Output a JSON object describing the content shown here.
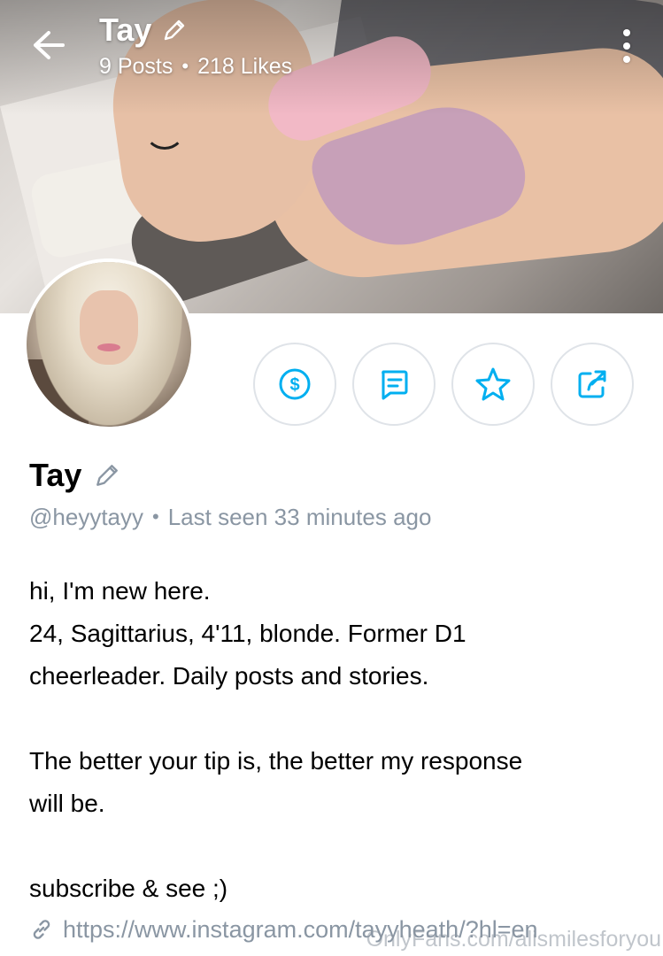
{
  "header": {
    "title": "Tay",
    "posts": "9 Posts",
    "likes": "218 Likes"
  },
  "icons": {
    "back": "arrow-left-icon",
    "edit": "pencil-icon",
    "menu": "more-vertical-icon",
    "tip": "dollar-circle-icon",
    "message": "message-icon",
    "favorite": "star-icon",
    "share": "share-icon",
    "link": "link-icon"
  },
  "colors": {
    "accent": "#00aff0",
    "muted_text": "#8a96a3",
    "button_border": "#dfe3e8"
  },
  "profile": {
    "name": "Tay",
    "handle": "@heyytayy",
    "last_seen": "Last seen 33 minutes ago",
    "bio": {
      "line1": "hi, I'm new here.",
      "line2": "24, Sagittarius, 4'11, blonde. Former D1",
      "line3": "cheerleader. Daily posts and stories.",
      "line4": "The better your tip is, the better my response",
      "line5": "will be.",
      "line6": "subscribe & see ;)"
    },
    "link": "https://www.instagram.com/tayyheath/?hl=en"
  },
  "watermark": "OnlyFans.com/alismilesforyou"
}
